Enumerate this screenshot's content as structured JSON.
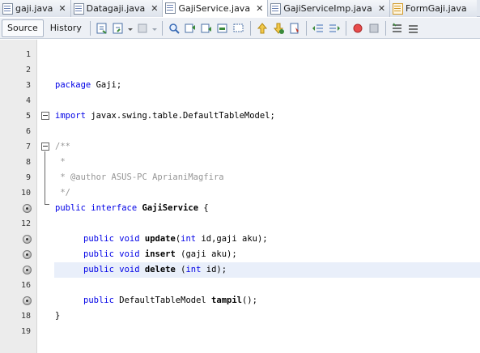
{
  "tabs": [
    {
      "label": "gaji.java",
      "icon": "java-file-icon",
      "active": false
    },
    {
      "label": "Datagaji.java",
      "icon": "java-file-icon",
      "active": false
    },
    {
      "label": "GajiService.java",
      "icon": "java-file-icon",
      "active": true
    },
    {
      "label": "GajiServiceImp.java",
      "icon": "java-file-icon",
      "active": false
    },
    {
      "label": "FormGaji.java",
      "icon": "form-file-icon",
      "active": false
    }
  ],
  "toolbar": {
    "source_label": "Source",
    "history_label": "History"
  },
  "editor": {
    "lines": [
      {
        "num": "1",
        "text": ""
      },
      {
        "num": "2",
        "text": ""
      },
      {
        "num": "3",
        "text": "package Gaji;"
      },
      {
        "num": "4",
        "text": ""
      },
      {
        "num": "5",
        "text": "import javax.swing.table.DefaultTableModel;"
      },
      {
        "num": "6",
        "text": ""
      },
      {
        "num": "7",
        "text": "/**"
      },
      {
        "num": "8",
        "text": " *"
      },
      {
        "num": "9",
        "text": " * @author ASUS-PC AprianiMagfira"
      },
      {
        "num": "10",
        "text": " */"
      },
      {
        "num": "",
        "text": "public interface GajiService {"
      },
      {
        "num": "12",
        "text": ""
      },
      {
        "num": "",
        "text": "public void update(int id,gaji aku);"
      },
      {
        "num": "",
        "text": "public void insert (gaji aku);"
      },
      {
        "num": "",
        "text": "public void delete (int id);"
      },
      {
        "num": "16",
        "text": ""
      },
      {
        "num": "",
        "text": "public DefaultTableModel tampil();"
      },
      {
        "num": "18",
        "text": "}"
      },
      {
        "num": "19",
        "text": ""
      }
    ]
  },
  "colors": {
    "keyword": "#0000e6",
    "comment": "#969696",
    "current_line": "#e9effa"
  }
}
